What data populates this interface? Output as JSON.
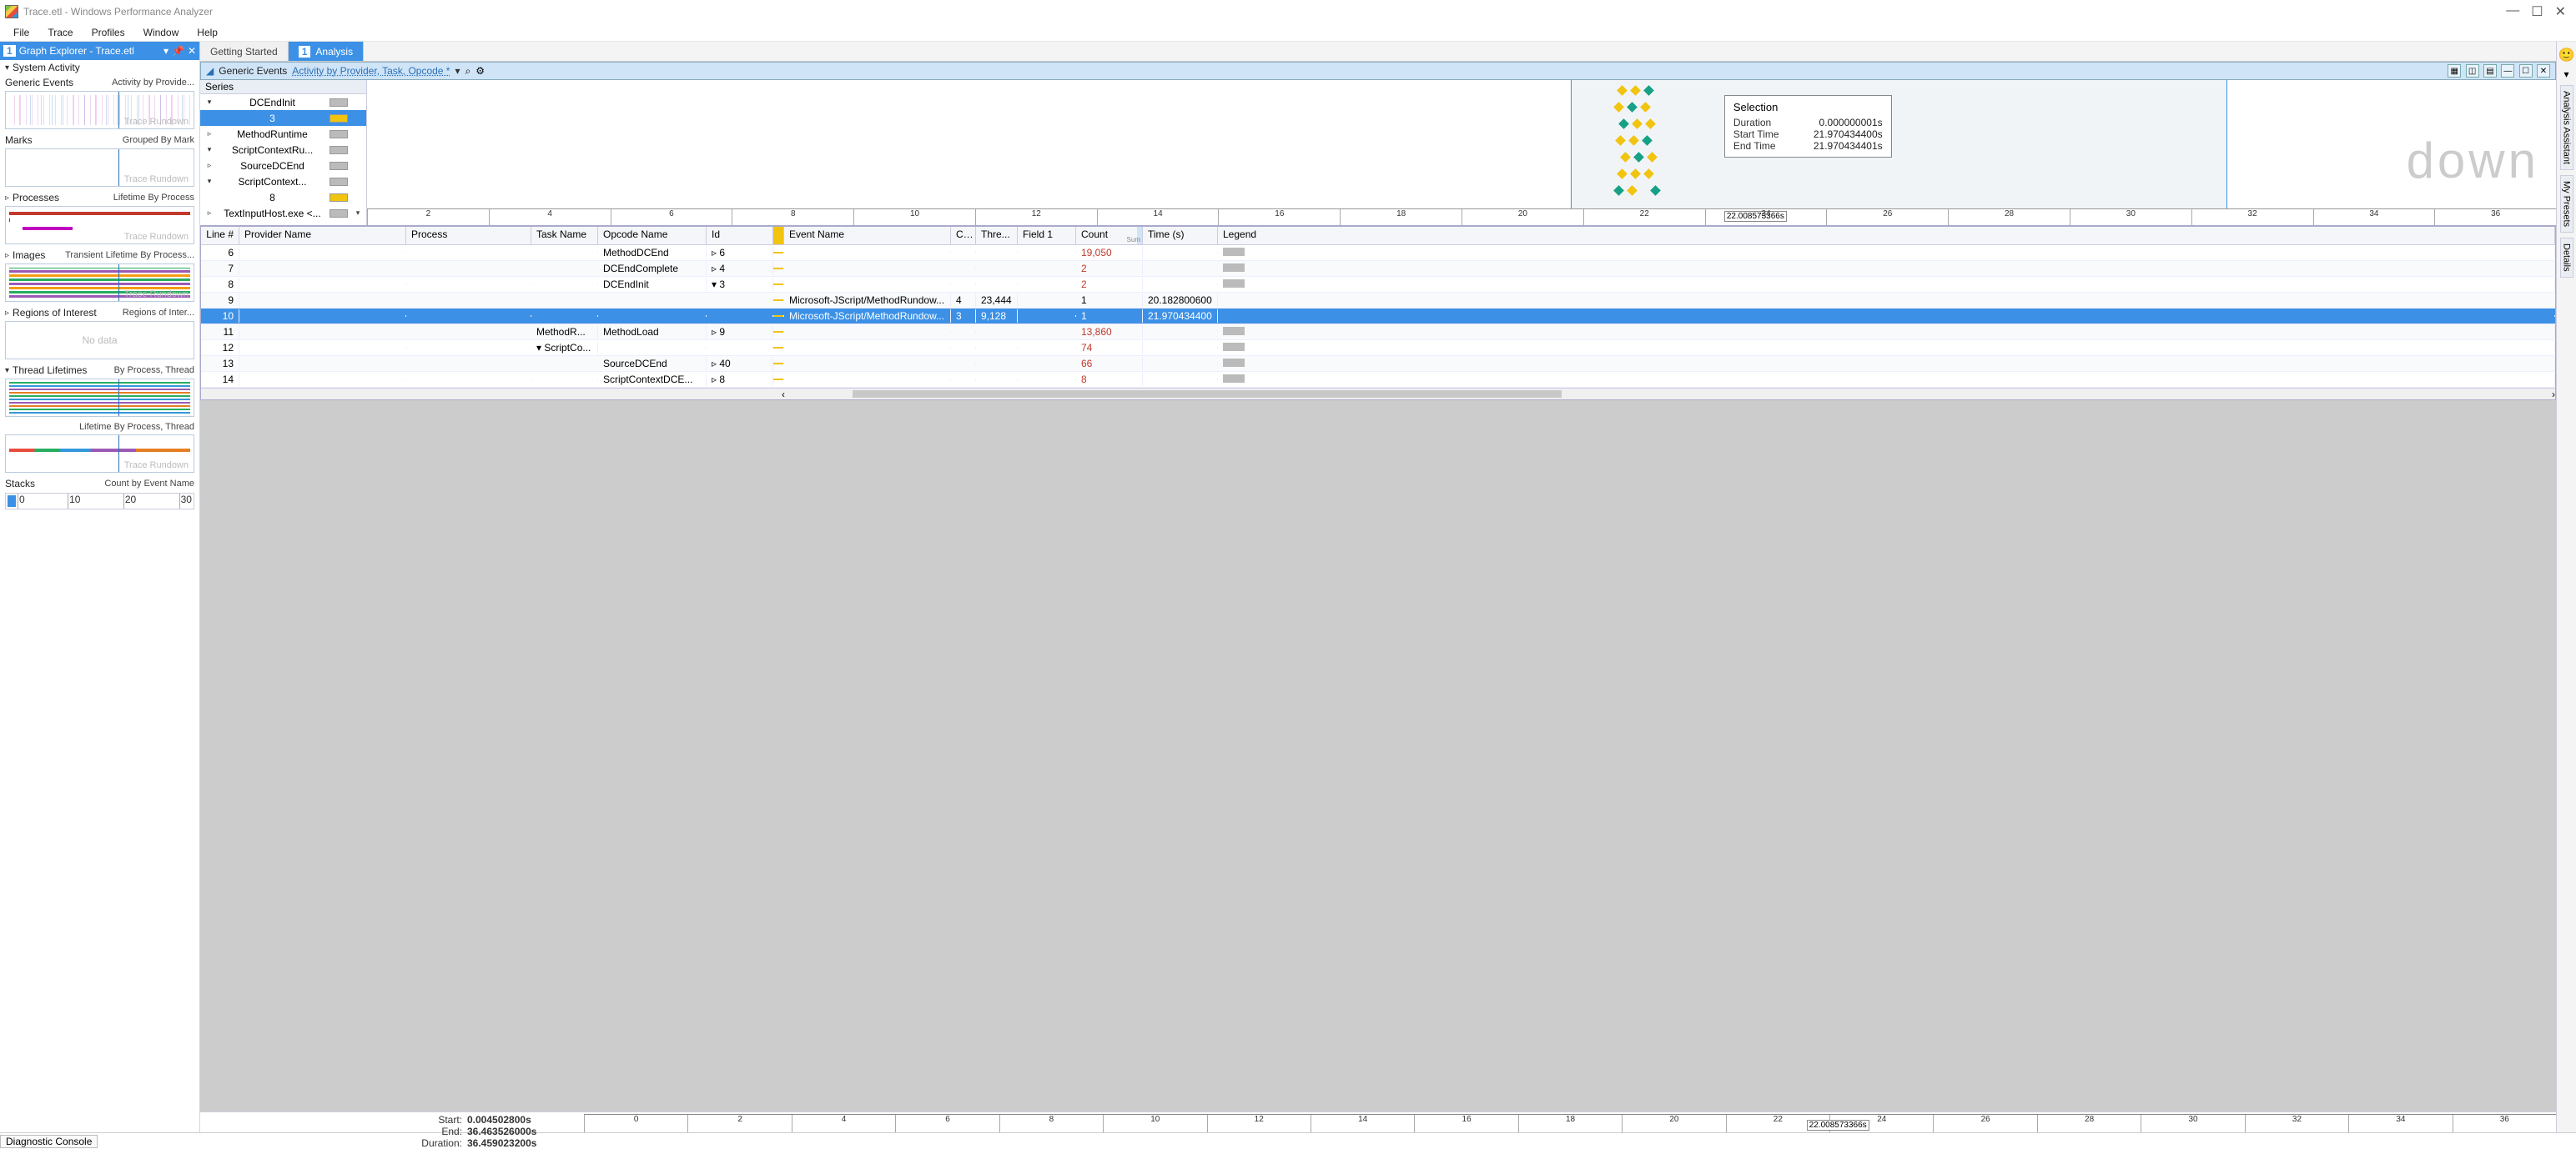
{
  "window": {
    "title": "Trace.etl - Windows Performance Analyzer",
    "minimize": "—",
    "maximize": "☐",
    "close": "✕"
  },
  "menu": [
    "File",
    "Trace",
    "Profiles",
    "Window",
    "Help"
  ],
  "left": {
    "header_badge": "1",
    "header_title": "Graph Explorer - Trace.etl",
    "sections": [
      {
        "name": "System Activity",
        "sub": "",
        "thumbs": [
          {
            "t1": "Generic Events",
            "t2": "Activity by Provide...",
            "cls": "thumb-events thumb-vline"
          },
          {
            "t1": "Marks",
            "t2": "Grouped By Mark",
            "cls": "thumb thumb-vline"
          },
          {
            "t1": "Processes",
            "t2": "Lifetime By Process",
            "cls": "thumb-proc thumb-vline"
          },
          {
            "t1": "Images",
            "t2": "Transient Lifetime By Process...",
            "cls": "thumb-imgs thumb-vline"
          },
          {
            "t1": "Regions of Interest",
            "t2": "Regions of Inter...",
            "cls": "thumb-nodata",
            "nodata": "No data"
          },
          {
            "t1": "Thread Lifetimes",
            "t2": "By Process, Thread",
            "cls": "thumb-threads thumb-vline"
          },
          {
            "t1": "",
            "t2": "Lifetime By Process, Thread",
            "cls": "thumb-threads2 thumb-vline"
          },
          {
            "t1": "Stacks",
            "t2": "Count by Event Name",
            "ruler": true
          }
        ]
      }
    ],
    "watermark": "Trace Rundown",
    "ruler_ticks": [
      "0",
      "10",
      "20",
      "30"
    ]
  },
  "tabs": [
    {
      "label": "Getting Started",
      "active": false
    },
    {
      "badge": "1",
      "label": "Analysis",
      "active": true
    }
  ],
  "panel": {
    "title": "Generic Events",
    "preset": "Activity by Provider, Task, Opcode *",
    "caret": "◢",
    "star": "▾",
    "search": "⌕",
    "gear": "⚙",
    "right_icons": [
      "▦",
      "◫",
      "▤",
      "—",
      "☐",
      "✕"
    ]
  },
  "series": {
    "header": "Series",
    "rows": [
      {
        "tw": "▾",
        "label": "DCEndInit",
        "swatch": "grey",
        "exp": ""
      },
      {
        "tw": "",
        "label": "3",
        "swatch": "y",
        "sel": true,
        "exp": ""
      },
      {
        "tw": "▹",
        "label": "MethodRuntime",
        "swatch": "grey",
        "exp": ""
      },
      {
        "tw": "▾",
        "label": "ScriptContextRu...",
        "swatch": "grey",
        "exp": ""
      },
      {
        "tw": "▹",
        "label": "SourceDCEnd",
        "swatch": "grey",
        "exp": ""
      },
      {
        "tw": "▾",
        "label": "ScriptContext...",
        "swatch": "grey",
        "exp": ""
      },
      {
        "tw": "",
        "label": "8",
        "swatch": "y",
        "exp": ""
      },
      {
        "tw": "▹",
        "label": "TextInputHost.exe <...",
        "swatch": "grey",
        "exp": "▾"
      }
    ]
  },
  "timeline": {
    "watermark": "down",
    "ticks": [
      "2",
      "4",
      "6",
      "8",
      "10",
      "12",
      "14",
      "16",
      "18",
      "20",
      "22",
      "24",
      "26",
      "28",
      "30",
      "32",
      "34",
      "36"
    ],
    "tip": "22.008573366s",
    "selection": {
      "title": "Selection",
      "rows": [
        {
          "k": "Duration",
          "v": "0.000000001s"
        },
        {
          "k": "Start Time",
          "v": "21.970434400s"
        },
        {
          "k": "End Time",
          "v": "21.970434401s"
        }
      ]
    }
  },
  "table": {
    "columns": [
      "Line #",
      "Provider Name",
      "Process",
      "Task Name",
      "Opcode Name",
      "Id",
      "",
      "Event Name",
      "C...",
      "Thre...",
      "Field 1",
      "Count",
      "Time (s)",
      "Legend"
    ],
    "rows": [
      {
        "line": "6",
        "op": "MethodDCEnd",
        "id": "▹ 6",
        "cnt": "19,050",
        "red": true,
        "leg": true
      },
      {
        "line": "7",
        "op": "DCEndComplete",
        "id": "▹ 4",
        "cnt": "2",
        "red": true,
        "leg": true
      },
      {
        "line": "8",
        "op": "DCEndInit",
        "id": "▾ 3",
        "cnt": "2",
        "red": true,
        "leg": true
      },
      {
        "line": "9",
        "evt": "Microsoft-JScript/MethodRundow...",
        "cpu": "4",
        "thr": "23,444",
        "cnt": "1",
        "time": "20.182800600"
      },
      {
        "line": "10",
        "evt": "Microsoft-JScript/MethodRundow...",
        "cpu": "3",
        "thr": "9,128",
        "cnt": "1",
        "time": "21.970434400",
        "sel": true
      },
      {
        "line": "11",
        "task": "MethodR...",
        "op": "MethodLoad",
        "id": "▹ 9",
        "cnt": "13,860",
        "red": true,
        "leg": true
      },
      {
        "line": "12",
        "task": "▾ ScriptCo...",
        "cnt": "74",
        "red": true,
        "leg": true
      },
      {
        "line": "13",
        "op": "SourceDCEnd",
        "id": "▹ 40",
        "cnt": "66",
        "red": true,
        "leg": true
      },
      {
        "line": "14",
        "op": "ScriptContextDCE...",
        "id": "▹ 8",
        "cnt": "8",
        "red": true,
        "leg": true
      }
    ]
  },
  "bottom": {
    "info": [
      {
        "l": "Start:",
        "v": "0.004502800s"
      },
      {
        "l": "End:",
        "v": "36.463526000s"
      },
      {
        "l": "Duration:",
        "v": "36.459023200s"
      }
    ],
    "ticks": [
      "0",
      "2",
      "4",
      "6",
      "8",
      "10",
      "12",
      "14",
      "16",
      "18",
      "20",
      "22",
      "24",
      "26",
      "28",
      "30",
      "32",
      "34",
      "36"
    ],
    "tip": "22.008573366s"
  },
  "status": {
    "diag": "Diagnostic Console"
  },
  "rail": {
    "smiley": "🙂",
    "tabs": [
      "Analysis Assistant",
      "My Presets",
      "Details"
    ]
  }
}
